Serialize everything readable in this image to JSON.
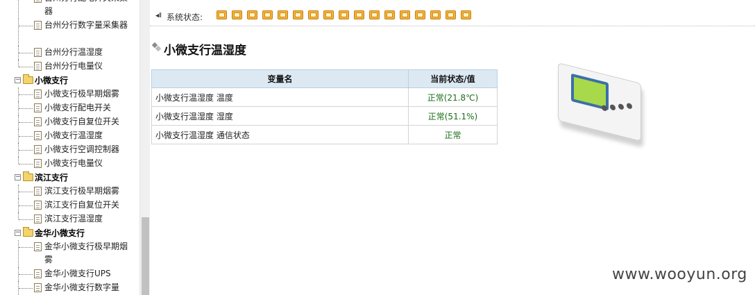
{
  "tree": {
    "top_items": [
      {
        "label": "台州分行配电开关采集器"
      },
      {
        "label": "台州分行数字量采集器"
      },
      {
        "label": "台州分行温湿度"
      },
      {
        "label": "台州分行电量仪"
      }
    ],
    "groups": [
      {
        "label": "小微支行",
        "items": [
          {
            "label": "小微支行极早期烟雾"
          },
          {
            "label": "小微支行配电开关"
          },
          {
            "label": "小微支行自复位开关"
          },
          {
            "label": "小微支行温湿度"
          },
          {
            "label": "小微支行空调控制器"
          },
          {
            "label": "小微支行电量仪"
          }
        ]
      },
      {
        "label": "滨江支行",
        "items": [
          {
            "label": "滨江支行极早期烟雾"
          },
          {
            "label": "滨江支行自复位开关"
          },
          {
            "label": "滨江支行温湿度"
          }
        ]
      },
      {
        "label": "金华小微支行",
        "items": [
          {
            "label": "金华小微支行极早期烟雾"
          },
          {
            "label": "金华小微支行UPS"
          },
          {
            "label": "金华小微支行数字量"
          }
        ]
      }
    ]
  },
  "status": {
    "label": "系统状态:",
    "light_count": 17,
    "light_color": "#f4b43a"
  },
  "main": {
    "title": "小微支行温湿度",
    "table": {
      "headers": [
        "变量名",
        "当前状态/值"
      ],
      "rows": [
        {
          "name": "小微支行温湿度 温度",
          "value": "正常(21.8℃)"
        },
        {
          "name": "小微支行温湿度 湿度",
          "value": "正常(51.1%)"
        },
        {
          "name": "小微支行温湿度 通信状态",
          "value": "正常"
        }
      ]
    }
  },
  "watermark": "www.wooyun.org"
}
